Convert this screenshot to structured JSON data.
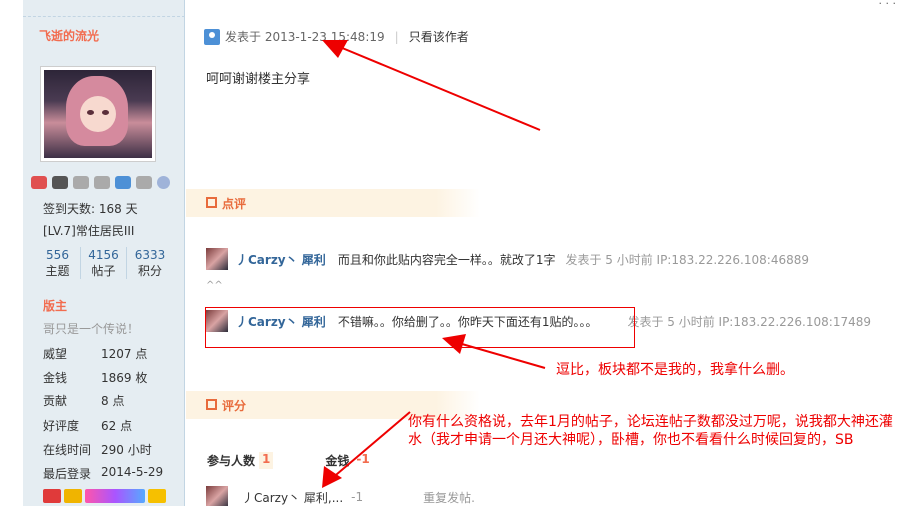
{
  "sidebar": {
    "username": "飞逝的流光",
    "checkin_label": "签到天数:",
    "checkin_value": "168 天",
    "level": "[LV.7]常住居民III",
    "stats": [
      {
        "value": "556",
        "label": "主题"
      },
      {
        "value": "4156",
        "label": "帖子"
      },
      {
        "value": "6333",
        "label": "积分"
      }
    ],
    "role": "版主",
    "motto": "哥只是一个传说！",
    "fields": [
      {
        "key": "威望",
        "value": "1207 点"
      },
      {
        "key": "金钱",
        "value": "1869 枚"
      },
      {
        "key": "贡献",
        "value": "8 点"
      },
      {
        "key": "好评度",
        "value": "62 点"
      },
      {
        "key": "在线时间",
        "value": "290 小时"
      },
      {
        "key": "最后登录",
        "value": "2014-5-29"
      }
    ]
  },
  "post": {
    "posted_at": "发表于 2013-1-23 15:48:19",
    "only_author": "只看该作者",
    "content": "呵呵谢谢楼主分享"
  },
  "review": {
    "title": "点评",
    "comments": [
      {
        "author": "丿Carzy丶 犀利",
        "text": "而且和你此贴内容完全一样。。就改了1字",
        "meta": "发表于 5 小时前 IP:183.22.226.108:46889"
      },
      {
        "author": "丿Carzy丶 犀利",
        "text": "不错嘛。。你给删了。。你昨天下面还有1贴的。。。",
        "meta": "发表于 5 小时前 IP:183.22.226.108:17489"
      }
    ],
    "dots": "^^"
  },
  "rating": {
    "title": "评分",
    "participants_label": "参与人数",
    "participants_count": "1",
    "money_label": "金钱",
    "money_value": "-1",
    "row": {
      "author": "丿Carzy丶 犀利,...",
      "score": "-1",
      "reason": "重复发帖."
    }
  },
  "annotations": {
    "reply_note": "逗比，板块都不是我的，我拿什么删。",
    "rant_note": "你有什么资格说，去年1月的帖子，论坛连帖子数都没过万呢，说我都大神还灌水（我才申请一个月还大神呢），卧槽，你也不看看什么时候回复的，SB"
  },
  "colors": {
    "accent": "#e86b3c",
    "link": "#336699",
    "annotation": "#ee0000",
    "sidebar_bg": "#e5edf2"
  }
}
